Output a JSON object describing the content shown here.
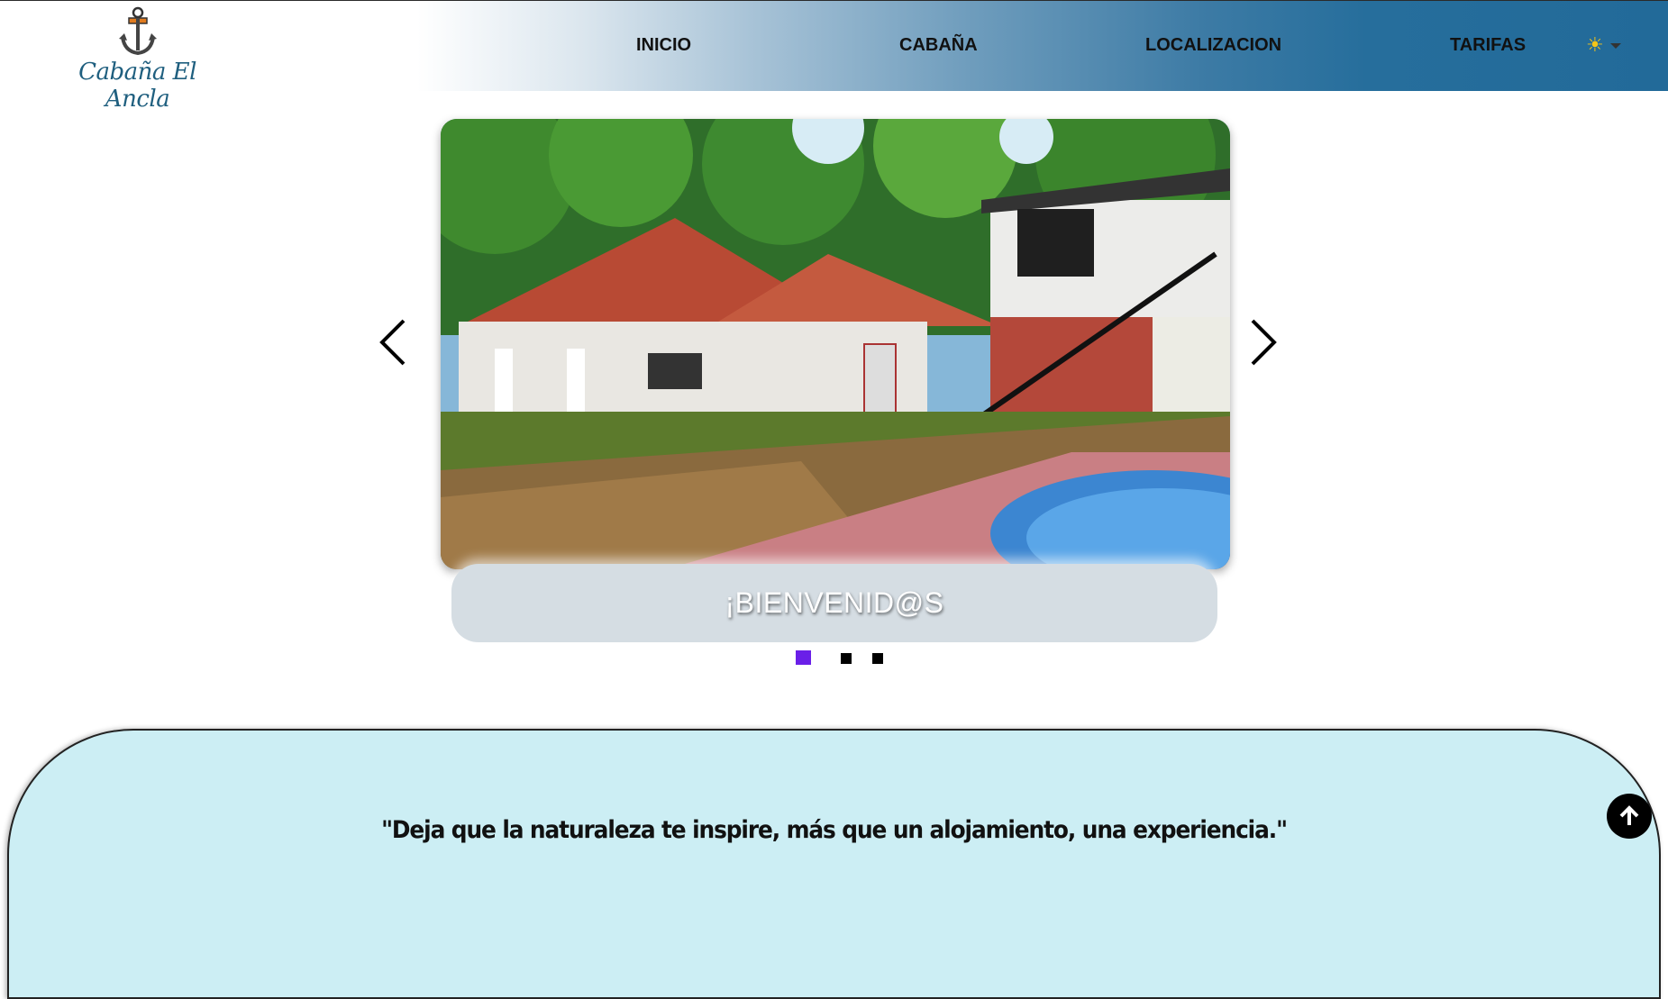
{
  "header": {
    "logo_text": "Cabaña El Ancla",
    "nav": [
      {
        "label": "INICIO"
      },
      {
        "label": "CABAÑA"
      },
      {
        "label": "LOCALIZACION"
      },
      {
        "label": "TARIFAS"
      }
    ],
    "theme_icon": "sun-icon"
  },
  "carousel": {
    "caption": "¡BIENVENID@S",
    "slide_count": 3,
    "active_slide": 1,
    "indicator_active_color": "#6a1fe8"
  },
  "quote_section": {
    "text": "\"Deja que la naturaleza te inspire, más que un alojamiento, una experiencia.\"",
    "background_color": "#cceef4"
  },
  "colors": {
    "header_gradient_end": "#226a99",
    "caption_bg": "#d5dde3"
  }
}
